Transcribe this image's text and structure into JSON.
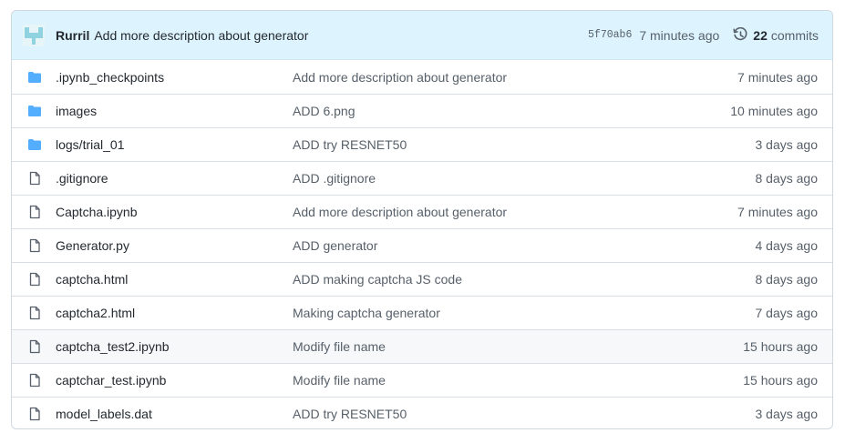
{
  "latest_commit": {
    "author": "Rurril",
    "message": "Add more description about generator",
    "sha": "5f70ab6",
    "time": "7 minutes ago",
    "commits_count": "22",
    "commits_label": "commits"
  },
  "colors": {
    "header_bg": "#ddf4ff",
    "folder_icon": "#54aeff",
    "file_icon": "#57606a"
  },
  "files": [
    {
      "type": "folder",
      "icon": "folder-icon",
      "name": ".ipynb_checkpoints",
      "message": "Add more description about generator",
      "age": "7 minutes ago"
    },
    {
      "type": "folder",
      "icon": "folder-icon",
      "name": "images",
      "message": "ADD 6.png",
      "age": "10 minutes ago"
    },
    {
      "type": "folder",
      "icon": "folder-icon",
      "name": "logs/trial_01",
      "message": "ADD try RESNET50",
      "age": "3 days ago"
    },
    {
      "type": "file",
      "icon": "file-icon",
      "name": ".gitignore",
      "message": "ADD .gitignore",
      "age": "8 days ago"
    },
    {
      "type": "file",
      "icon": "file-icon",
      "name": "Captcha.ipynb",
      "message": "Add more description about generator",
      "age": "7 minutes ago"
    },
    {
      "type": "file",
      "icon": "file-icon",
      "name": "Generator.py",
      "message": "ADD generator",
      "age": "4 days ago"
    },
    {
      "type": "file",
      "icon": "file-icon",
      "name": "captcha.html",
      "message": "ADD making captcha JS code",
      "age": "8 days ago"
    },
    {
      "type": "file",
      "icon": "file-icon",
      "name": "captcha2.html",
      "message": "Making captcha generator",
      "age": "7 days ago"
    },
    {
      "type": "file",
      "icon": "file-icon",
      "name": "captcha_test2.ipynb",
      "message": "Modify file name",
      "age": "15 hours ago",
      "hovered": true
    },
    {
      "type": "file",
      "icon": "file-icon",
      "name": "captchar_test.ipynb",
      "message": "Modify file name",
      "age": "15 hours ago"
    },
    {
      "type": "file",
      "icon": "file-icon",
      "name": "model_labels.dat",
      "message": "ADD try RESNET50",
      "age": "3 days ago"
    }
  ]
}
